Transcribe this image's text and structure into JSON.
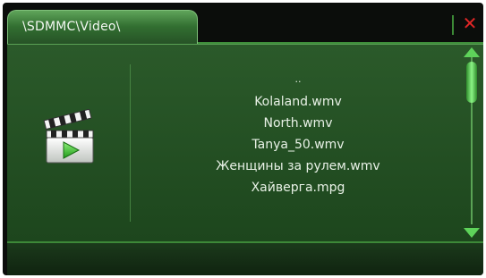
{
  "header": {
    "path": "\\SDMMC\\Video\\",
    "close_icon": "close-icon",
    "close_glyph": "✕",
    "close_color": "#e02626"
  },
  "sidebar": {
    "icon": "video-clapperboard-icon"
  },
  "file_list": {
    "items": [
      "..",
      "Kolaland.wmv",
      "North.wmv",
      "Tanya_50.wmv",
      "Женщины за рулем.wmv",
      "Хайверга.mpg"
    ]
  },
  "scrollbar": {
    "up_icon": "scroll-up-arrow-icon",
    "down_icon": "scroll-down-arrow-icon",
    "position": 0
  },
  "colors": {
    "accent": "#5ed35a",
    "panel": "#2b5a2a",
    "text": "#e8f1e6"
  }
}
